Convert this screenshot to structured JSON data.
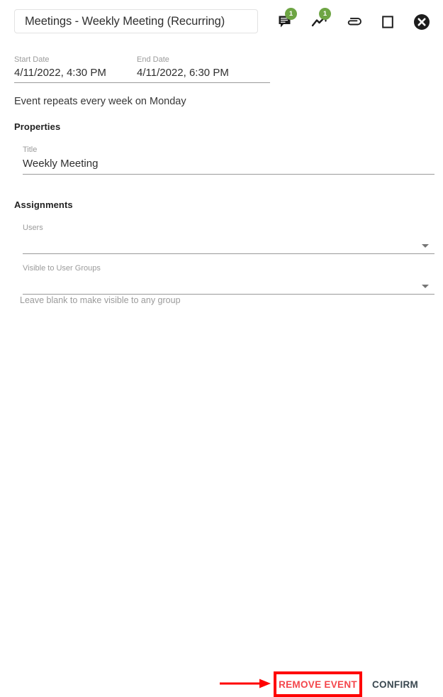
{
  "header": {
    "event_title": "Meetings - Weekly Meeting (Recurring)",
    "icons": [
      {
        "name": "comments-icon",
        "badge": "1"
      },
      {
        "name": "trend-chart-icon",
        "badge": "1"
      },
      {
        "name": "attachment-paperclip-icon",
        "badge": ""
      },
      {
        "name": "maximize-square-icon",
        "badge": ""
      },
      {
        "name": "close-circle-icon",
        "badge": ""
      }
    ],
    "badge_color": "#6ea544"
  },
  "dates": {
    "start_label": "Start Date",
    "start_value": "4/11/2022, 4:30 PM",
    "end_label": "End Date",
    "end_value": "4/11/2022, 6:30 PM"
  },
  "recurrence": {
    "text": "Event repeats every week on Monday"
  },
  "properties": {
    "section_label": "Properties",
    "title_field": {
      "label": "Title",
      "value": "Weekly Meeting",
      "placeholder": "Title"
    }
  },
  "assignments": {
    "section_label": "Assignments",
    "users_field": {
      "label": "Users",
      "value": "",
      "placeholder": "Users"
    },
    "groups_field": {
      "label": "Visible to User Groups",
      "value": "",
      "placeholder": "Visible to User Groups"
    },
    "helper_text": "Leave blank to make visible to any group"
  },
  "footer": {
    "remove_label": "REMOVE EVENT",
    "confirm_label": "CONFIRM",
    "highlight_color": "#ff0000",
    "remove_text_color": "#f4464b",
    "confirm_text_color": "#39474f"
  }
}
